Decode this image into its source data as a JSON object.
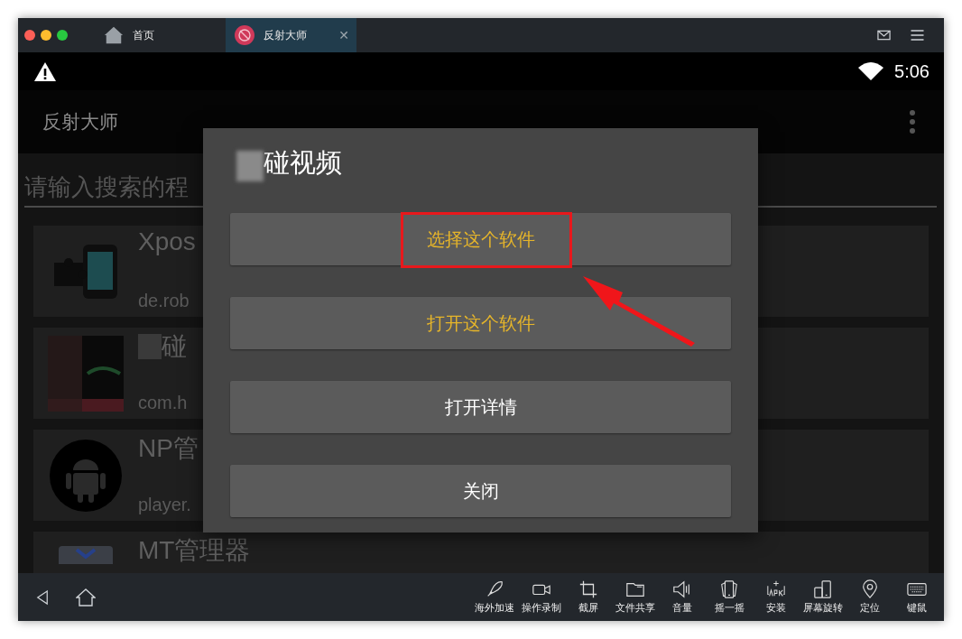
{
  "window": {
    "tabs": [
      {
        "label": "首页",
        "selected": false
      },
      {
        "label": "反射大师",
        "selected": true,
        "close_glyph": "✕"
      }
    ]
  },
  "status_bar": {
    "time": "5:06"
  },
  "app_bar": {
    "title": "反射大师"
  },
  "search": {
    "placeholder": "请输入搜索的程"
  },
  "apps": [
    {
      "name": "Xpos",
      "package": "de.rob"
    },
    {
      "name": "碰",
      "package": "com.h"
    },
    {
      "name": "NP管",
      "package": "player."
    },
    {
      "name": "MT管理器"
    }
  ],
  "dialog": {
    "title": "碰视频",
    "buttons": [
      {
        "label": "选择这个软件",
        "accent": true,
        "highlighted": true
      },
      {
        "label": "打开这个软件",
        "accent": true,
        "highlighted": false
      },
      {
        "label": "打开详情",
        "accent": false,
        "highlighted": false
      },
      {
        "label": "关闭",
        "accent": false,
        "highlighted": false
      }
    ]
  },
  "tools": [
    {
      "label": "海外加速"
    },
    {
      "label": "操作录制"
    },
    {
      "label": "截屏"
    },
    {
      "label": "文件共享"
    },
    {
      "label": "音量"
    },
    {
      "label": "摇一摇"
    },
    {
      "label": "安装"
    },
    {
      "label": "屏幕旋转"
    },
    {
      "label": "定位"
    },
    {
      "label": "键鼠"
    }
  ]
}
